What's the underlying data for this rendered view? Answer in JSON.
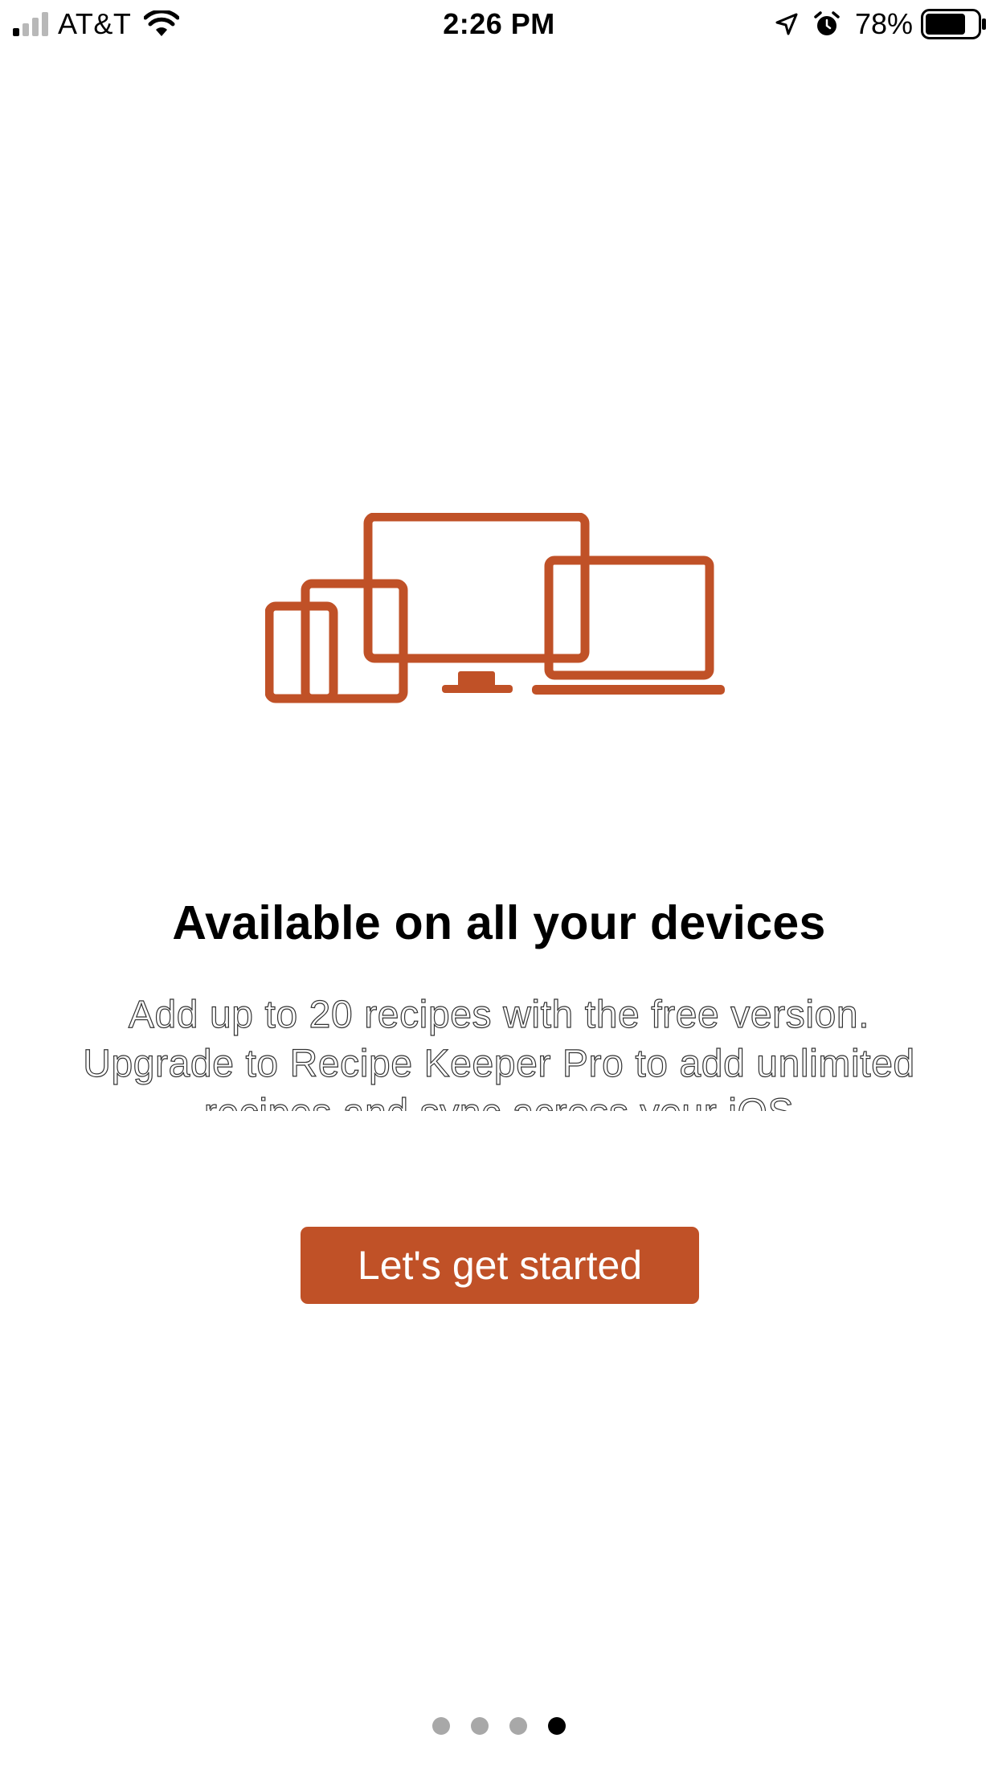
{
  "status_bar": {
    "carrier": "AT&T",
    "time": "2:26 PM",
    "battery_percent": "78%",
    "battery_level": 0.78,
    "signal_bars_active": 1,
    "signal_bars_total": 4,
    "icons": [
      "signal-icon",
      "wifi-icon",
      "location-icon",
      "alarm-icon",
      "battery-icon"
    ]
  },
  "onboarding": {
    "illustration_icon": "devices-icon",
    "title": "Available on all your devices",
    "description": "Add up to 20 recipes with the free version. Upgrade to Recipe Keeper Pro to add unlimited recipes and sync across your iOS",
    "button_label": "Let's get started"
  },
  "page_indicator": {
    "total": 4,
    "current": 4
  },
  "colors": {
    "accent": "#c05127",
    "dot_inactive": "#a8a8a8",
    "dot_active": "#000000"
  }
}
